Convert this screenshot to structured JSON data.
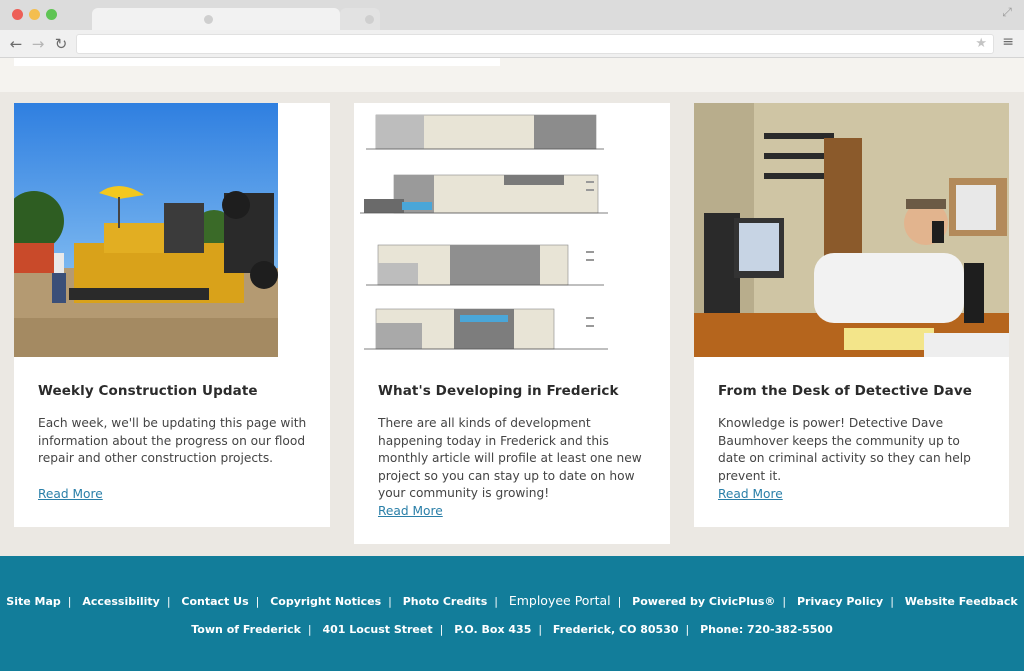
{
  "cards": [
    {
      "title": "Weekly Construction Update",
      "body": "Each week, we'll be updating this page with information about the progress on our flood repair and other construction projects.",
      "link": "Read More"
    },
    {
      "title": "What's Developing in Frederick",
      "body": "There are all kinds of development happening today in Frederick and this monthly article will profile at least one new project so you can stay up to date on how your community is growing!",
      "link": "Read More"
    },
    {
      "title": "From the Desk of Detective Dave",
      "body": "Knowledge is power! Detective Dave Baumhover keeps the community up to date on criminal activity so they can help prevent it.",
      "link": "Read More"
    }
  ],
  "footer": {
    "links": [
      "Site Map",
      "Accessibility",
      "Contact Us",
      "Copyright Notices",
      "Photo Credits",
      "Employee Portal",
      "Powered by CivicPlus®",
      "Privacy Policy",
      "Website Feedback"
    ],
    "address": [
      "Town of Frederick",
      "401 Locust Street",
      "P.O. Box 435",
      "Frederick, CO 80530",
      "Phone: 720-382-5500"
    ]
  },
  "colors": {
    "footer_bg": "#127d9a",
    "link": "#2a7fa8",
    "page_bg": "#ebe8e3"
  }
}
